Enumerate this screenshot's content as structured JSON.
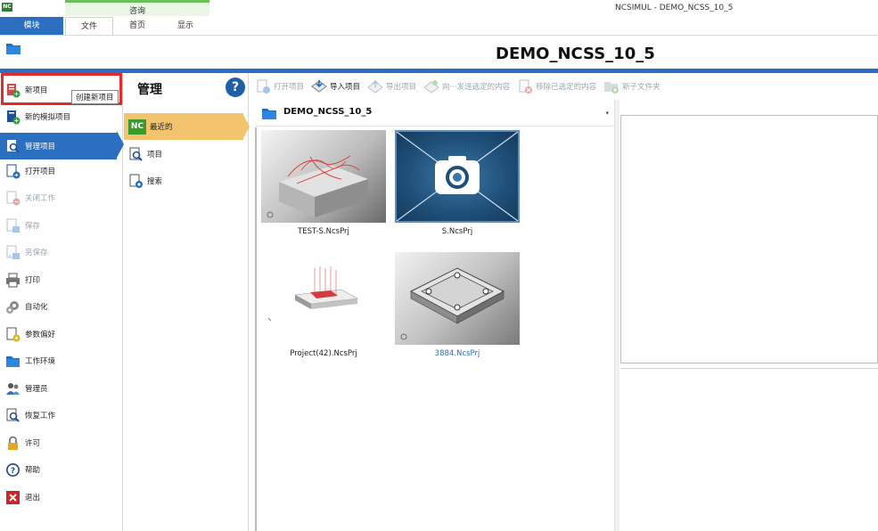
{
  "window": {
    "logo": "NC",
    "title": "NCSIMUL - DEMO_NCSS_10_5",
    "context_group": "咨询",
    "tabs": {
      "module": "模块",
      "file": "文件",
      "home": "首页",
      "display": "显示"
    }
  },
  "header": {
    "project_title": "DEMO_NCSS_10_5"
  },
  "sidebar": {
    "items": [
      {
        "label": "新项目",
        "icon": "new-project-icon"
      },
      {
        "label": "新的模拟项目",
        "icon": "new-simulation-project-icon"
      },
      {
        "label": "管理项目",
        "icon": "manage-projects-icon"
      },
      {
        "label": "打开项目",
        "icon": "open-project-icon"
      },
      {
        "label": "关闭工作",
        "icon": "close-work-icon"
      },
      {
        "label": "保存",
        "icon": "save-icon"
      },
      {
        "label": "另保存",
        "icon": "save-as-icon"
      },
      {
        "label": "打印",
        "icon": "print-icon"
      },
      {
        "label": "自动化",
        "icon": "automation-gear-icon"
      },
      {
        "label": "参数偏好",
        "icon": "preferences-icon"
      },
      {
        "label": "工作环境",
        "icon": "workspace-folder-icon"
      },
      {
        "label": "管理员",
        "icon": "administrator-icon"
      },
      {
        "label": "恢复工作",
        "icon": "restore-work-icon"
      },
      {
        "label": "许可",
        "icon": "license-lock-icon"
      },
      {
        "label": "帮助",
        "icon": "help-icon"
      },
      {
        "label": "退出",
        "icon": "exit-icon"
      }
    ],
    "tooltip": "创建新项目"
  },
  "management": {
    "title": "管理",
    "help": "?",
    "items": [
      {
        "label": "最近的",
        "badge": "NC"
      },
      {
        "label": "项目"
      },
      {
        "label": "搜索"
      }
    ]
  },
  "toolbar": {
    "open_project": "打开项目",
    "import_project": "导入项目",
    "export_project": "导出项目",
    "send_selected": "向···发送选定的内容",
    "remove_selected": "移除已选定的内容",
    "new_subfolder": "新子文件夹"
  },
  "folder": {
    "name": "DEMO_NCSS_10_5",
    "dropdown": "▾"
  },
  "files": [
    {
      "name": "TEST-S.NcsPrj"
    },
    {
      "name": "S.NcsPrj"
    },
    {
      "name": "Project(42).NcsPrj"
    },
    {
      "name": "3884.NcsPrj"
    }
  ],
  "colors": {
    "accent": "#2b6fc1",
    "highlight": "#e32b2b",
    "selection": "#f3c46d",
    "context_group": "#6bbf59"
  }
}
